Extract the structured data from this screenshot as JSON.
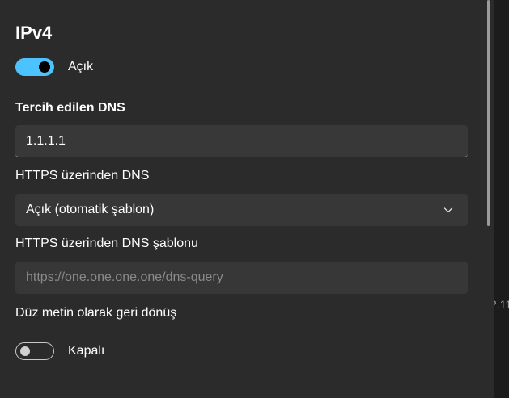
{
  "background_fragment": "2.11",
  "ipv4": {
    "title": "IPv4",
    "toggle": {
      "state": "on",
      "label": "Açık"
    }
  },
  "preferred_dns": {
    "label": "Tercih edilen DNS",
    "value": "1.1.1.1"
  },
  "dns_over_https": {
    "label": "HTTPS üzerinden DNS",
    "selected": "Açık (otomatik şablon)"
  },
  "dns_template": {
    "label": "HTTPS üzerinden DNS şablonu",
    "placeholder": "https://one.one.one.one/dns-query"
  },
  "plaintext_fallback": {
    "label": "Düz metin olarak geri dönüş",
    "toggle": {
      "state": "off",
      "label": "Kapalı"
    }
  },
  "colors": {
    "accent": "#4cc2ff",
    "panel": "#2b2b2b",
    "field": "#373737"
  },
  "icons": {
    "dropdown": "chevron-down-icon"
  }
}
